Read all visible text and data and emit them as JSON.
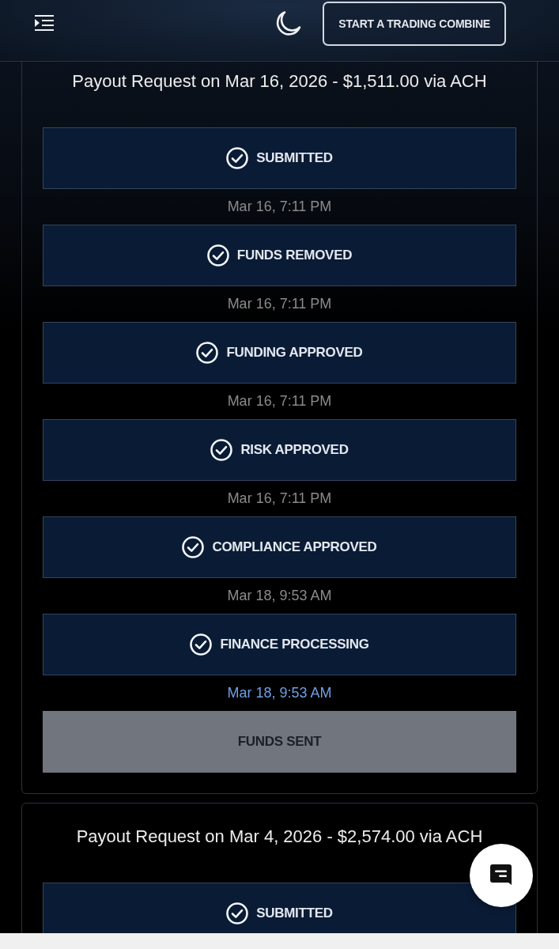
{
  "header": {
    "button": "START A TRADING COMBINE"
  },
  "payouts": [
    {
      "title": "Payout Request on Mar 16, 2026 - $1,511.00 via ACH",
      "steps": [
        {
          "label": "SUBMITTED",
          "completed": true,
          "time": "Mar 16, 7:11 PM",
          "latest": false
        },
        {
          "label": "FUNDS REMOVED",
          "completed": true,
          "time": "Mar 16, 7:11 PM",
          "latest": false
        },
        {
          "label": "FUNDING APPROVED",
          "completed": true,
          "time": "Mar 16, 7:11 PM",
          "latest": false
        },
        {
          "label": "RISK APPROVED",
          "completed": true,
          "time": "Mar 16, 7:11 PM",
          "latest": false
        },
        {
          "label": "COMPLIANCE APPROVED",
          "completed": true,
          "time": "Mar 18, 9:53 AM",
          "latest": false
        },
        {
          "label": "FINANCE PROCESSING",
          "completed": true,
          "time": "Mar 18, 9:53 AM",
          "latest": true
        },
        {
          "label": "FUNDS SENT",
          "completed": false
        }
      ]
    },
    {
      "title": "Payout Request on Mar 4, 2026 - $2,574.00 via ACH",
      "steps": [
        {
          "label": "SUBMITTED",
          "completed": true
        }
      ]
    }
  ]
}
